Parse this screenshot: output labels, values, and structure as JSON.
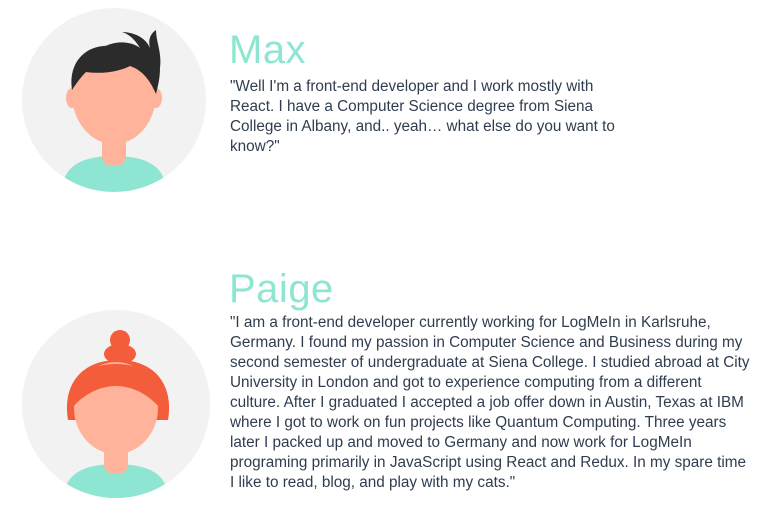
{
  "profiles": [
    {
      "id": "max",
      "name": "Max",
      "bio": "\"Well I'm a front-end developer and I work mostly with React. I have a Computer Science degree from Siena College in Albany, and.. yeah… what else do you want to know?\"",
      "avatar_icon": "male-avatar-icon"
    },
    {
      "id": "paige",
      "name": "Paige",
      "bio": "\"I am a front-end developer currently working for LogMeIn in Karlsruhe, Germany. I found my passion in Computer Science and Business during my second semester of undergraduate at Siena College. I studied abroad at City University in London and got to experience computing from a different culture. After I graduated I accepted a job offer down in Austin, Texas at IBM where I got to work on fun projects like Quantum Computing. Three years later I packed up and moved to Germany and now work for LogMeIn programing primarily in JavaScript using React and Redux. In my spare time I like to read, blog, and play with my cats.\"",
      "avatar_icon": "female-avatar-icon"
    }
  ],
  "colors": {
    "name_accent": "#8ee6d2",
    "body_text": "#2f3d4f",
    "avatar_bg": "#f2f2f2",
    "skin": "#ffb39a",
    "shirt": "#8ee6d2",
    "max_hair": "#2b2b2b",
    "paige_hair": "#f45d3c"
  }
}
